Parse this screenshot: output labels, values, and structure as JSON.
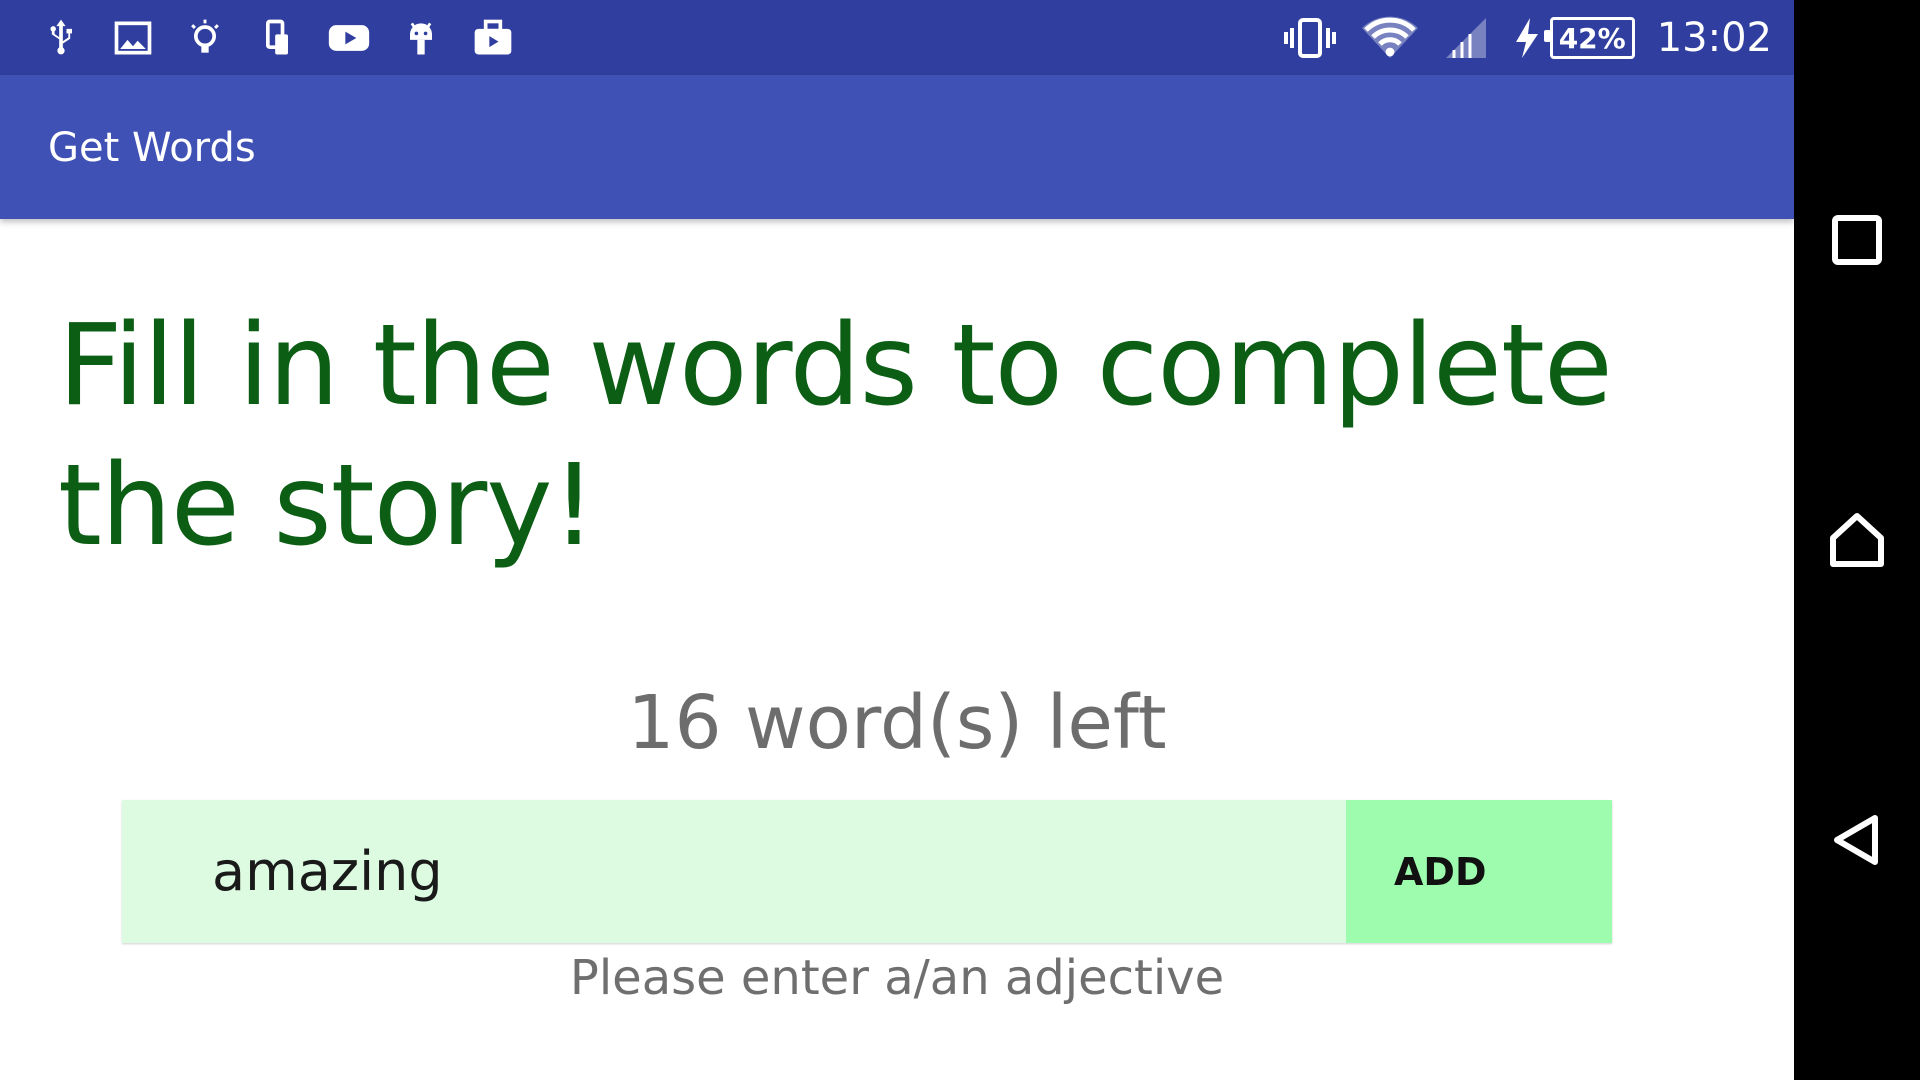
{
  "status_bar": {
    "left_icons": [
      "usb-icon",
      "image-icon",
      "lightbulb-icon",
      "phone-transfer-icon",
      "youtube-icon",
      "android-icon",
      "briefcase-icon"
    ],
    "right_icons": [
      "vibrate-icon",
      "wifi-icon",
      "signal-icon",
      "charging-icon"
    ],
    "battery": "42%",
    "time": "13:02"
  },
  "app_bar": {
    "title": "Get Words"
  },
  "main": {
    "heading": "Fill in the words to complete the story!",
    "words_left": "16 word(s) left",
    "input_value": "amazing",
    "add_label": "ADD",
    "hint": "Please enter a/an adjective"
  },
  "nav_bar": {
    "buttons": [
      "recents-icon",
      "home-icon",
      "back-icon"
    ]
  },
  "colors": {
    "status_bar": "#303f9f",
    "app_bar": "#3f51b5",
    "heading": "#0b5e14",
    "input_bg": "#dcfbe1",
    "button_bg": "#9efcae"
  }
}
